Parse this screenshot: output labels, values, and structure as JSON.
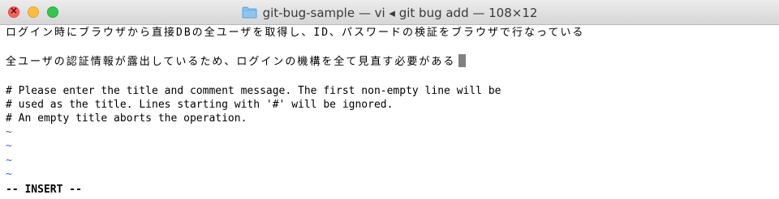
{
  "window": {
    "title": "git-bug-sample — vi ◂ git bug add — 108×12",
    "icon": "folder-icon"
  },
  "editor": {
    "lines": [
      "ログイン時にブラウザから直接DBの全ユーザを取得し、ID、パスワードの検証をブラウザで行なっている",
      "",
      "全ユーザの認証情報が露出しているため、ログインの機構を全て見直す必要がある",
      "",
      "# Please enter the title and comment message. The first non-empty line will be",
      "# used as the title. Lines starting with '#' will be ignored.",
      "# An empty title aborts the operation.",
      "~",
      "~",
      "~",
      "~"
    ],
    "mode": "-- INSERT --"
  },
  "colors": {
    "tilde": "#3c5ed8",
    "cursor": "#808080",
    "titlebar": "#e0e0e0"
  }
}
